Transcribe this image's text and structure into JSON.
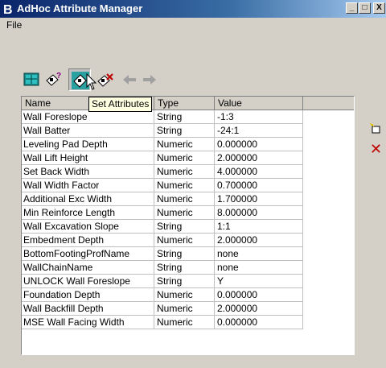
{
  "window": {
    "title": "AdHoc Attribute Manager",
    "controls": {
      "minimize": "_",
      "maximize": "□",
      "close": "X"
    }
  },
  "menu": {
    "file": "File"
  },
  "toolbar": {
    "buttons": [
      {
        "icon": "table-icon"
      },
      {
        "icon": "query-attributes-icon"
      },
      {
        "icon": "set-attributes-icon",
        "active": true
      },
      {
        "icon": "delete-attributes-icon"
      },
      {
        "icon": "arrow-left-icon"
      },
      {
        "icon": "arrow-right-icon"
      }
    ]
  },
  "tooltip": "Set Attributes",
  "grid": {
    "columns": [
      "Name",
      "Type",
      "Value"
    ],
    "rows": [
      [
        "Wall Foreslope",
        "String",
        "-1:3"
      ],
      [
        "Wall Batter",
        "String",
        "-24:1"
      ],
      [
        "Leveling Pad Depth",
        "Numeric",
        "0.000000"
      ],
      [
        "Wall Lift Height",
        "Numeric",
        "2.000000"
      ],
      [
        "Set Back Width",
        "Numeric",
        "4.000000"
      ],
      [
        "Wall Width Factor",
        "Numeric",
        "0.700000"
      ],
      [
        "Additional Exc Width",
        "Numeric",
        "1.700000"
      ],
      [
        "Min Reinforce Length",
        "Numeric",
        "8.000000"
      ],
      [
        "Wall Excavation Slope",
        "String",
        "1:1"
      ],
      [
        "Embedment Depth",
        "Numeric",
        "2.000000"
      ],
      [
        "BottomFootingProfName",
        "String",
        "none"
      ],
      [
        "WallChainName",
        "String",
        "none"
      ],
      [
        "UNLOCK Wall Foreslope",
        "String",
        "Y"
      ],
      [
        "Foundation Depth",
        "Numeric",
        "0.000000"
      ],
      [
        "Wall Backfill Depth",
        "Numeric",
        "2.000000"
      ],
      [
        "MSE Wall Facing Width",
        "Numeric",
        "0.000000"
      ]
    ]
  },
  "side": {
    "new_icon": "new-attribute-icon",
    "delete_icon": "delete-icon"
  },
  "colors": {
    "titlebar": "#0a246a",
    "face": "#d4d0c8",
    "tooltip": "#ffffe1",
    "delete": "#c00000"
  }
}
